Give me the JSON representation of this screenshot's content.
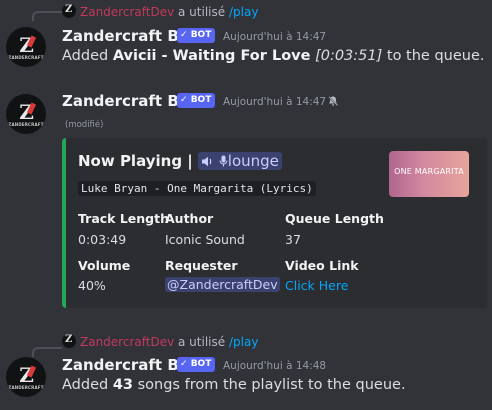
{
  "messages": [
    {
      "reply": {
        "user": "ZandercraftDev",
        "used": "a utilisé",
        "command": "/play"
      },
      "author": "Zandercraft Bot",
      "bot_tag": "BOT",
      "timestamp": "Aujourd'hui à 14:47",
      "content": {
        "prefix": "Added ",
        "track": "Avicii - Waiting For Love",
        "duration": "[0:03:51]",
        "suffix": " to the queue."
      }
    },
    {
      "author": "Zandercraft Bot",
      "bot_tag": "BOT",
      "timestamp": "Aujourd'hui à 14:47",
      "modified": "(modifié)",
      "embed": {
        "title": "Now Playing |",
        "channel": "lounge",
        "track_title": "Luke Bryan - One Margarita (Lyrics)",
        "thumbnail_text": "ONE MARGARITA",
        "accent_color": "#23a55a",
        "fields": {
          "track_length": {
            "name": "Track Length",
            "value": "0:03:49"
          },
          "author": {
            "name": "Author",
            "value": "Iconic Sound"
          },
          "queue_length": {
            "name": "Queue Length",
            "value": "37"
          },
          "volume": {
            "name": "Volume",
            "value": "40%"
          },
          "requester": {
            "name": "Requester",
            "value": "@ZandercraftDev"
          },
          "video_link": {
            "name": "Video Link",
            "value": "Click Here"
          }
        }
      }
    },
    {
      "reply": {
        "user": "ZandercraftDev",
        "used": "a utilisé",
        "command": "/play"
      },
      "author": "Zandercraft Bot",
      "bot_tag": "BOT",
      "timestamp": "Aujourd'hui à 14:48",
      "content": {
        "prefix": "Added ",
        "count": "43",
        "suffix": " songs from the playlist to the queue."
      }
    }
  ],
  "avatar_text": {
    "letter": "Z",
    "word": "ZANDERCRAFT"
  }
}
